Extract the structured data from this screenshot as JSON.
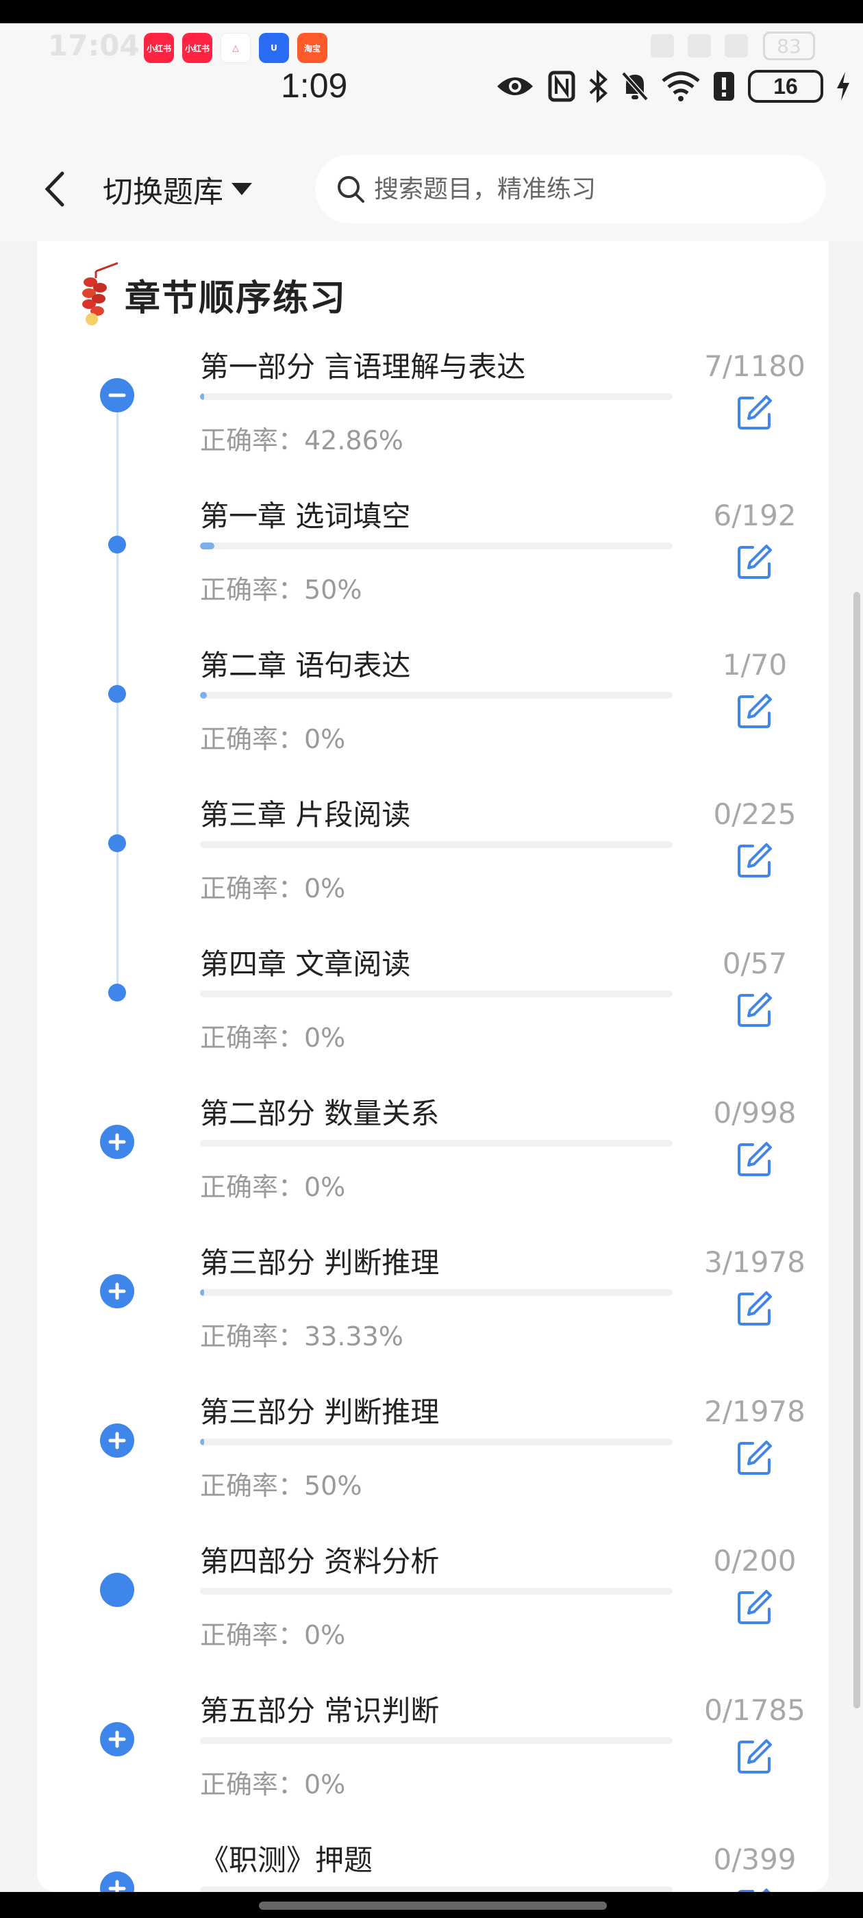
{
  "status": {
    "time": "1:09",
    "ghost_time": "17:04",
    "battery": "16",
    "ghost_battery": "83",
    "mini_apps": [
      {
        "label": "小红书",
        "color": "#ff2442"
      },
      {
        "label": "小红书",
        "color": "#ff2442"
      },
      {
        "label": "△",
        "color": "#ffffff"
      },
      {
        "label": "U",
        "color": "#2a6df4"
      },
      {
        "label": "淘宝",
        "color": "#ff5a2a"
      }
    ]
  },
  "header": {
    "switch_label": "切换题库",
    "search_placeholder": "搜索题目，精准练习"
  },
  "section": {
    "title": "章节顺序练习"
  },
  "items": [
    {
      "title": "第一部分 言语理解与表达",
      "accuracy": "正确率：42.86%",
      "count": "7/1180",
      "progress": 0.006,
      "marker": "minus"
    },
    {
      "title": "第一章 选词填空",
      "accuracy": "正确率：50%",
      "count": "6/192",
      "progress": 0.031,
      "marker": "dot"
    },
    {
      "title": "第二章 语句表达",
      "accuracy": "正确率：0%",
      "count": "1/70",
      "progress": 0.014,
      "marker": "dot"
    },
    {
      "title": "第三章 片段阅读",
      "accuracy": "正确率：0%",
      "count": "0/225",
      "progress": 0,
      "marker": "dot"
    },
    {
      "title": "第四章 文章阅读",
      "accuracy": "正确率：0%",
      "count": "0/57",
      "progress": 0,
      "marker": "dot"
    },
    {
      "title": "第二部分 数量关系",
      "accuracy": "正确率：0%",
      "count": "0/998",
      "progress": 0,
      "marker": "plus"
    },
    {
      "title": "第三部分 判断推理",
      "accuracy": "正确率：33.33%",
      "count": "3/1978",
      "progress": 0.0015,
      "marker": "plus"
    },
    {
      "title": "第三部分 判断推理",
      "accuracy": "正确率：50%",
      "count": "2/1978",
      "progress": 0.001,
      "marker": "plus"
    },
    {
      "title": "第四部分 资料分析",
      "accuracy": "正确率：0%",
      "count": "0/200",
      "progress": 0,
      "marker": "filled"
    },
    {
      "title": "第五部分 常识判断",
      "accuracy": "正确率：0%",
      "count": "0/1785",
      "progress": 0,
      "marker": "plus"
    },
    {
      "title": "《职测》押题",
      "accuracy": "",
      "count": "0/399",
      "progress": 0,
      "marker": "plus"
    }
  ],
  "colors": {
    "accent": "#3f86ea",
    "progress": "#7bb0ea",
    "text_muted": "#9a9a9a"
  }
}
